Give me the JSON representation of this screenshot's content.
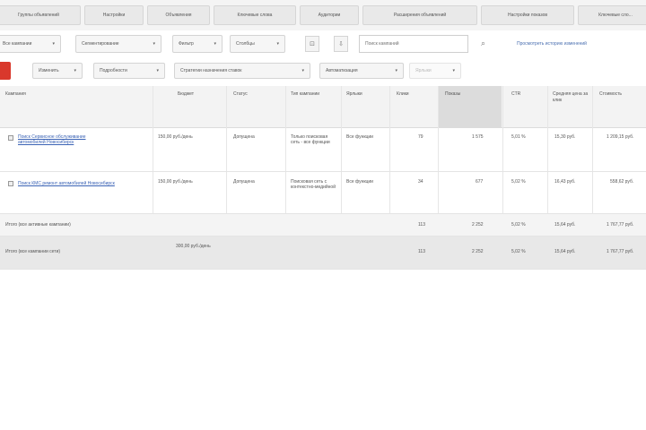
{
  "tabs": [
    "Группы объявлений",
    "Настройки",
    "Объявления",
    "Ключевые слова",
    "Аудитории",
    "Расширения объявлений",
    "Настройки показов",
    "Ключевые сло..."
  ],
  "toolbar": {
    "dropdowns": [
      "Все кампании",
      "Сегментирование",
      "Фильтр",
      "Столбцы"
    ],
    "search_placeholder": "Поиск кампаний",
    "link": "Просмотреть историю изменений"
  },
  "filters": {
    "items": [
      "Изменить",
      "Подробности",
      "Стратегии назначения ставок",
      "Автоматизация",
      "Ярлыки"
    ]
  },
  "columns": [
    "Кампания",
    "Бюджет",
    "Статус",
    "Тип кампании",
    "Ярлыки",
    "Клики",
    "Показы",
    "CTR",
    "Средняя цена за клик",
    "Стоимость"
  ],
  "rows": [
    {
      "campaign": "Поиск Сервисное обслуживание автомобилей Новосибирск",
      "budget": "150,00 руб./день",
      "status": "Допущена",
      "type": "Только поисковая сеть - все функции",
      "labels": "Все функции",
      "clicks": "79",
      "impr": "1 575",
      "ctr": "5,01 %",
      "cpc": "15,30 руб.",
      "cost": "1 209,15 руб."
    },
    {
      "campaign": "Поиск КМС ремонт автомобилей Новосибирск",
      "budget": "150,00 руб./день",
      "status": "Допущена",
      "type": "Поисковая сеть с контекстно-медийной",
      "labels": "Все функции",
      "clicks": "34",
      "impr": "677",
      "ctr": "5,02 %",
      "cpc": "16,43 руб.",
      "cost": "558,62 руб."
    }
  ],
  "summary": {
    "label": "Итого (все активные кампании)",
    "clicks": "113",
    "impr": "2 252",
    "ctr": "5,02 %",
    "cpc": "15,64 руб.",
    "cost": "1 767,77 руб."
  },
  "total": {
    "label": "Итого (все кампании сети)",
    "budget": "300,00 руб./день",
    "clicks": "113",
    "impr": "2 252",
    "ctr": "5,02 %",
    "cpc": "15,64 руб.",
    "cost": "1 767,77 руб."
  },
  "colors": {
    "accent": "#d9382c",
    "link": "#3b63b5"
  }
}
